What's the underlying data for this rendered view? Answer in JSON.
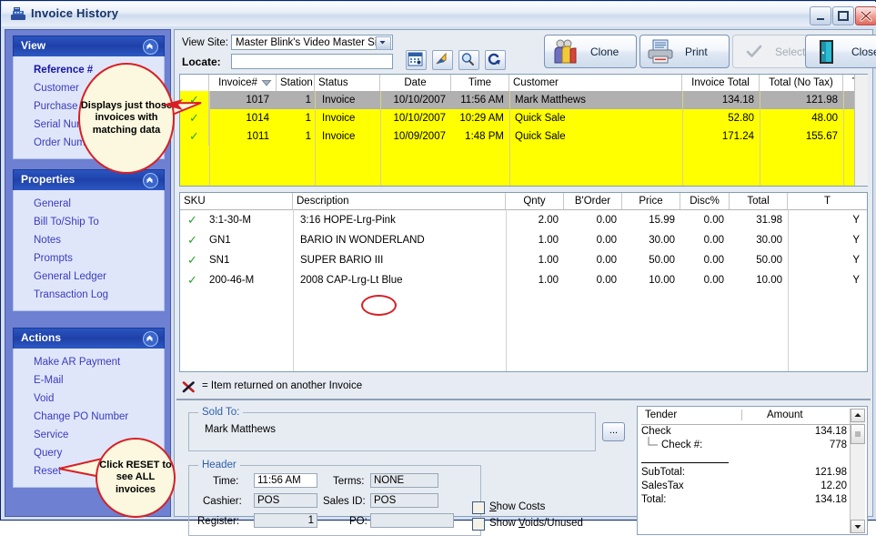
{
  "window": {
    "title": "Invoice History",
    "icon": "cash-register-icon",
    "minimize": "_",
    "maximize": "□",
    "close": "✕"
  },
  "sidebar": {
    "sections": [
      {
        "title": "View",
        "collapse_icon": "chevron-up-icon",
        "items": [
          {
            "label": "Reference #",
            "active": true
          },
          {
            "label": "Customer",
            "active": false
          },
          {
            "label": "Purchase Order",
            "active": false
          },
          {
            "label": "Serial Number",
            "active": false
          },
          {
            "label": "Order Number",
            "active": false
          }
        ]
      },
      {
        "title": "Properties",
        "collapse_icon": "chevron-up-icon",
        "items": [
          {
            "label": "General",
            "active": false
          },
          {
            "label": "Bill To/Ship To",
            "active": false
          },
          {
            "label": "Notes",
            "active": false
          },
          {
            "label": "Prompts",
            "active": false
          },
          {
            "label": "General Ledger",
            "active": false
          },
          {
            "label": "Transaction Log",
            "active": false
          }
        ]
      },
      {
        "title": "Actions",
        "collapse_icon": "chevron-up-icon",
        "items": [
          {
            "label": "Make AR Payment",
            "active": false
          },
          {
            "label": "E-Mail",
            "active": false
          },
          {
            "label": "Void",
            "active": false
          },
          {
            "label": "Change PO Number",
            "active": false
          },
          {
            "label": "Service",
            "active": false
          },
          {
            "label": "Query",
            "active": false
          },
          {
            "label": "Reset",
            "active": false
          }
        ]
      }
    ]
  },
  "toolbar": {
    "view_site_label": "View Site:",
    "view_site_value": "Master Blink's Video Master Site",
    "locate_label": "Locate:",
    "locate_value": "",
    "icon_buttons": [
      {
        "name": "calendar-icon"
      },
      {
        "name": "jump-arrow-icon"
      },
      {
        "name": "search-icon"
      },
      {
        "name": "refresh-icon"
      }
    ],
    "buttons": [
      {
        "label": "Clone",
        "icon": "people-icon",
        "disabled": false
      },
      {
        "label": "Print",
        "icon": "printer-icon",
        "disabled": false
      },
      {
        "label": "Select",
        "icon": "check-icon",
        "disabled": true
      },
      {
        "label": "Close",
        "icon": "door-icon",
        "disabled": false
      }
    ]
  },
  "invoice_grid": {
    "columns": [
      "",
      "Invoice#",
      "Station",
      "Status",
      "Date",
      "Time",
      "Customer",
      "Invoice Total",
      "Total (No Tax)",
      "T"
    ],
    "sort_icon": "sort-descending-icon",
    "rows": [
      {
        "flag": "✓",
        "invoice": "1017",
        "station": "1",
        "status": "Invoice",
        "date": "10/10/2007",
        "time": "11:56 AM",
        "customer": "Mark Matthews",
        "invoice_total": "134.18",
        "total_no_tax": "121.98",
        "selected": true
      },
      {
        "flag": "✓",
        "invoice": "1014",
        "station": "1",
        "status": "Invoice",
        "date": "10/10/2007",
        "time": "10:29 AM",
        "customer": "Quick Sale",
        "invoice_total": "52.80",
        "total_no_tax": "48.00",
        "selected": false
      },
      {
        "flag": "✓",
        "invoice": "1011",
        "station": "1",
        "status": "Invoice",
        "date": "10/09/2007",
        "time": "1:48 PM",
        "customer": "Quick Sale",
        "invoice_total": "171.24",
        "total_no_tax": "155.67",
        "selected": false
      }
    ]
  },
  "detail_grid": {
    "columns": [
      "SKU",
      "Description",
      "Qnty",
      "B'Order",
      "Price",
      "Disc%",
      "Total",
      "T"
    ],
    "rows": [
      {
        "flag": "✓",
        "sku": "3:1-30-M",
        "description": "3:16 HOPE-Lrg-Pink",
        "qnty": "2.00",
        "border": "0.00",
        "price": "15.99",
        "disc": "0.00",
        "total": "31.98",
        "t": "Y"
      },
      {
        "flag": "✓",
        "sku": "GN1",
        "description": "BARIO IN WONDERLAND",
        "qnty": "1.00",
        "border": "0.00",
        "price": "30.00",
        "disc": "0.00",
        "total": "30.00",
        "t": "Y"
      },
      {
        "flag": "✓",
        "sku": "SN1",
        "description": "SUPER BARIO III",
        "qnty": "1.00",
        "border": "0.00",
        "price": "50.00",
        "disc": "0.00",
        "total": "50.00",
        "t": "Y"
      },
      {
        "flag": "✓",
        "sku": "200-46-M",
        "description": "2008 CAP-Lrg-Lt Blue",
        "qnty": "1.00",
        "border": "0.00",
        "price": "10.00",
        "disc": "0.00",
        "total": "10.00",
        "t": "Y"
      }
    ]
  },
  "legend": {
    "icon": "red-x-icon",
    "text": "= Item returned on another Invoice"
  },
  "sold_to": {
    "title": "Sold To:",
    "value": "Mark Matthews",
    "browse_label": "..."
  },
  "header_group": {
    "title": "Header",
    "time_label": "Time:",
    "time_value": "11:56 AM",
    "cashier_label": "Cashier:",
    "cashier_value": "POS",
    "register_label": "Register:",
    "register_value": "1",
    "terms_label": "Terms:",
    "terms_value": "NONE",
    "sales_id_label": "Sales ID:",
    "sales_id_value": "POS",
    "po_label": "PO:",
    "po_value": ""
  },
  "checkboxes": [
    {
      "label": "Show Costs",
      "checked": false
    },
    {
      "label": "Show Voids/Unused",
      "checked": false
    }
  ],
  "tender": {
    "col_tender": "Tender",
    "col_amount": "Amount",
    "rows": [
      {
        "label": "Check",
        "amount": "134.18",
        "indent": false
      },
      {
        "label": "Check #:",
        "amount": "778",
        "indent": true
      }
    ],
    "totals": [
      {
        "label": "SubTotal:",
        "amount": "121.98"
      },
      {
        "label": "SalesTax",
        "amount": "12.20"
      },
      {
        "label": "Total:",
        "amount": "134.18"
      }
    ],
    "scroll_up_icon": "chevron-up-icon",
    "scroll_down_icon": "chevron-down-icon"
  },
  "callouts": [
    {
      "text": "Displays just those invoices with matching data"
    },
    {
      "text": "Click RESET to see ALL invoices"
    }
  ],
  "colors": {
    "highlight_yellow": "#ffff00",
    "selected_gray": "#b0b0b0",
    "accent_blue": "#1e41a8",
    "callout_red": "#d81f26",
    "check_green": "#27a327"
  }
}
